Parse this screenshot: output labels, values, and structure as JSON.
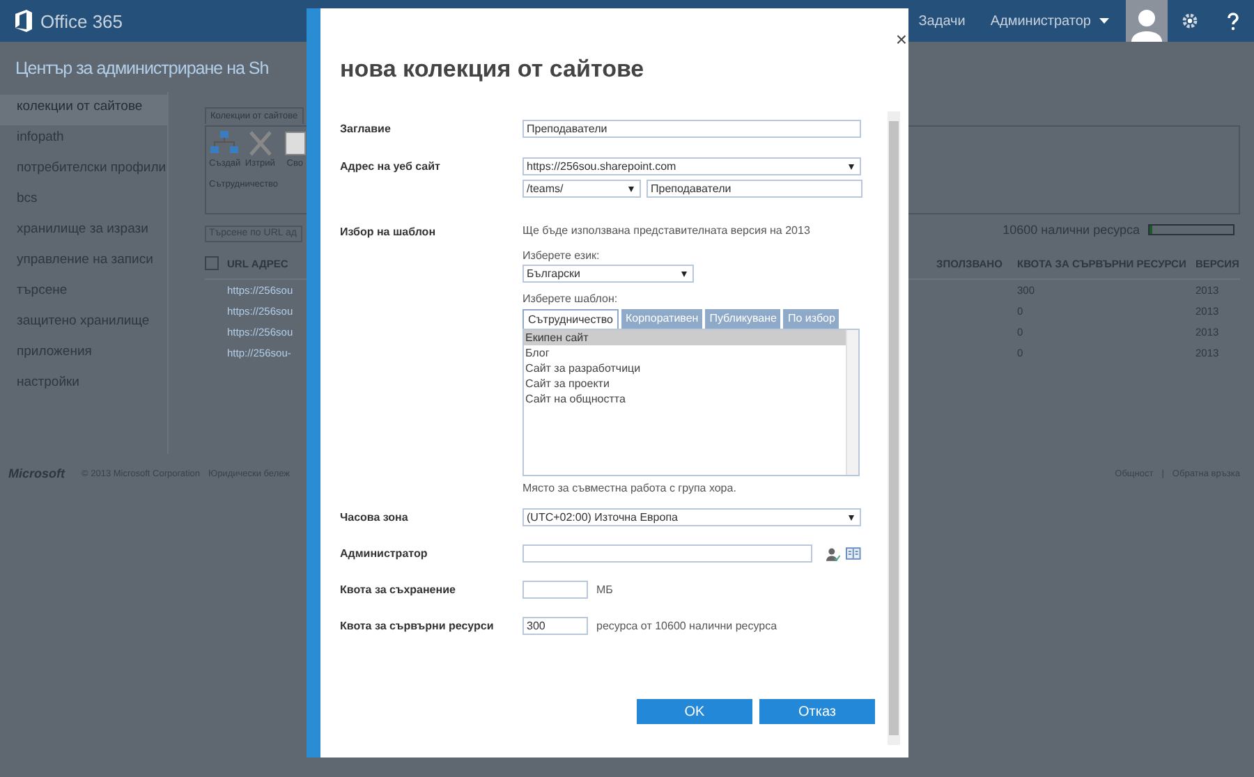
{
  "topbar": {
    "logo": "Office 365",
    "links": [
      "Задачи"
    ],
    "user_menu": "Администратор"
  },
  "page_title": "Център за администриране на Sh",
  "sidebar": {
    "items": [
      {
        "label": "колекции от сайтове",
        "selected": true
      },
      {
        "label": "infopath",
        "selected": false
      },
      {
        "label": "потребителски профили",
        "selected": false
      },
      {
        "label": "bcs",
        "selected": false
      },
      {
        "label": "хранилище за изрази",
        "selected": false
      },
      {
        "label": "управление на записи",
        "selected": false
      },
      {
        "label": "търсене",
        "selected": false
      },
      {
        "label": "защитено хранилище",
        "selected": false
      },
      {
        "label": "приложения",
        "selected": false
      },
      {
        "label": "настройки",
        "selected": false
      }
    ]
  },
  "ribbon": {
    "tab": "Колекции от сайтове",
    "buttons": [
      {
        "label": "Създай",
        "kind": "create"
      },
      {
        "label": "Изтрий",
        "kind": "delete"
      },
      {
        "label": "Сво",
        "kind": "properties"
      }
    ],
    "group_label": "Сътрудничество"
  },
  "search": {
    "placeholder": "Търсене по URL ад"
  },
  "resources": {
    "label": "10600 налични ресурса",
    "level": 0.03
  },
  "table": {
    "select_all": {
      "checked": false
    },
    "columns": [
      "URL АДРЕС",
      "ЗПОЛЗВАНО",
      "КВОТА ЗА СЪРВЪРНИ РЕСУРСИ",
      "ВЕРСИЯ"
    ],
    "rows": [
      {
        "url": "https://256sou",
        "quota": "300",
        "version": "2013"
      },
      {
        "url": "https://256sou",
        "quota": "0",
        "version": "2013"
      },
      {
        "url": "https://256sou",
        "quota": "0",
        "version": "2013"
      },
      {
        "url": "http://256sou-",
        "quota": "0",
        "version": "2013"
      }
    ]
  },
  "footer": {
    "logo": "Microsoft",
    "copyright": "© 2013 Microsoft Corporation",
    "legal": "Юридически бележ",
    "links": [
      "Общност",
      "Обратна връзка"
    ],
    "separator": "|"
  },
  "dialog": {
    "title": "нова колекция от сайтове",
    "close": "×",
    "title_field": {
      "label": "Заглавие",
      "value": "Преподаватели"
    },
    "address": {
      "label": "Адрес на уеб сайт",
      "domain": "https://256sou.sharepoint.com",
      "path": "/teams/",
      "name": "Преподаватели"
    },
    "template": {
      "label": "Избор на шаблон",
      "note": "Ще бъде използвана представителната версия на 2013",
      "language_label": "Изберете език:",
      "language": "Български",
      "template_label": "Изберете шаблон:",
      "tabs": [
        {
          "label": "Сътрудничество",
          "selected": true
        },
        {
          "label": "Корпоративен",
          "selected": false
        },
        {
          "label": "Публикуване",
          "selected": false
        },
        {
          "label": "По избор",
          "selected": false
        }
      ],
      "items": [
        {
          "label": "Екипен сайт",
          "selected": true
        },
        {
          "label": "Блог",
          "selected": false
        },
        {
          "label": "Сайт за разработчици",
          "selected": false
        },
        {
          "label": "Сайт за проекти",
          "selected": false
        },
        {
          "label": "Сайт на общността",
          "selected": false
        }
      ],
      "description": "Място за съвместна работа с група хора."
    },
    "timezone": {
      "label": "Часова зона",
      "value": "(UTC+02:00) Източна Европа"
    },
    "administrator": {
      "label": "Администратор"
    },
    "storage": {
      "label": "Квота за съхранение",
      "unit": "МБ"
    },
    "server_resources": {
      "label": "Квота за сървърни ресурси",
      "value": "300",
      "note": "ресурса от 10600 налични ресурса"
    },
    "buttons": [
      "OK",
      "Отказ"
    ]
  }
}
